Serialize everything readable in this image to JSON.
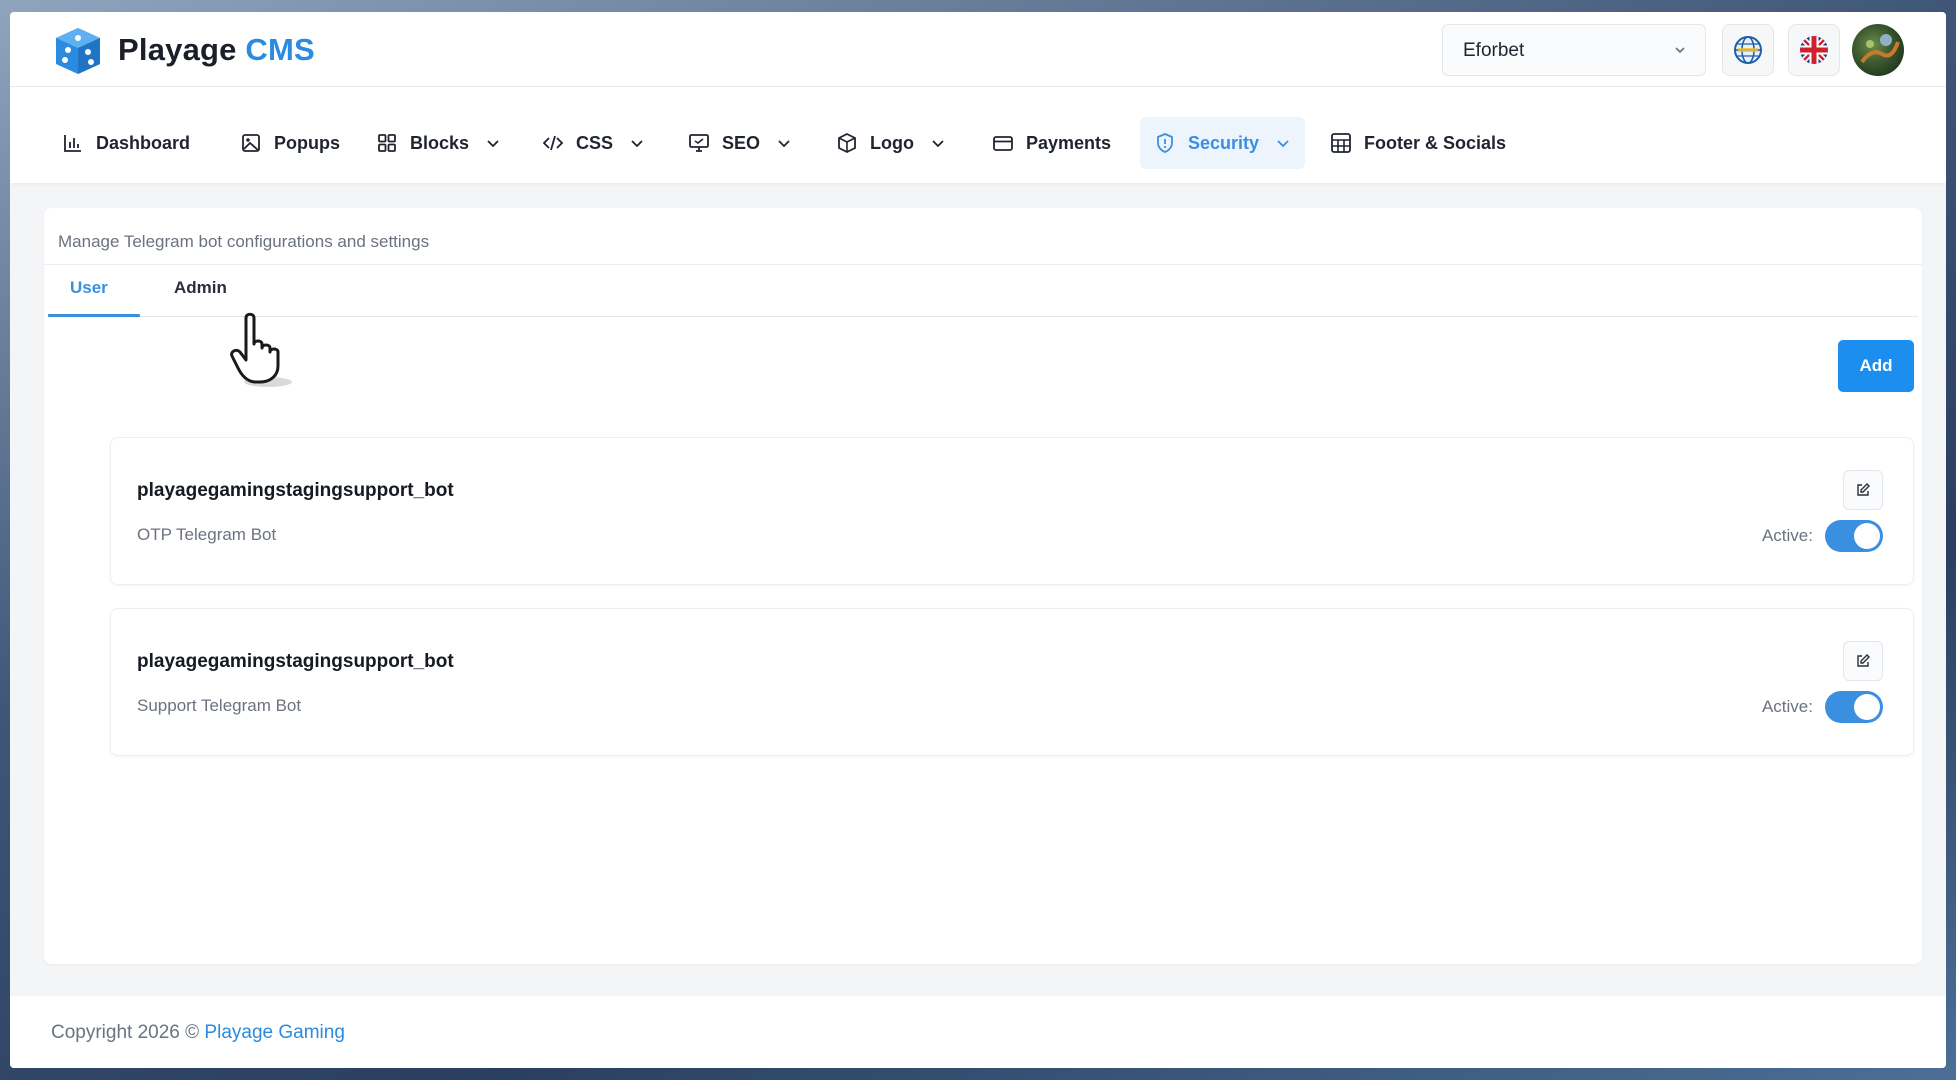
{
  "header": {
    "brand_name": "Playage",
    "brand_suffix": "CMS",
    "site_select_value": "Eforbet",
    "icons": [
      "globe-icon",
      "uk-flag-icon",
      "user-avatar"
    ]
  },
  "nav": {
    "items": [
      {
        "label": "Dashboard",
        "icon": "bar-chart-icon",
        "dropdown": false
      },
      {
        "label": "Popups",
        "icon": "image-icon",
        "dropdown": false
      },
      {
        "label": "Blocks",
        "icon": "grid-icon",
        "dropdown": true
      },
      {
        "label": "CSS",
        "icon": "code-icon",
        "dropdown": true
      },
      {
        "label": "SEO",
        "icon": "monitor-icon",
        "dropdown": true
      },
      {
        "label": "Logo",
        "icon": "box-icon",
        "dropdown": true
      },
      {
        "label": "Payments",
        "icon": "credit-card-icon",
        "dropdown": false
      },
      {
        "label": "Security",
        "icon": "shield-icon",
        "dropdown": true,
        "active": true
      },
      {
        "label": "Footer & Socials",
        "icon": "layout-icon",
        "dropdown": false
      }
    ]
  },
  "page": {
    "description": "Manage Telegram bot configurations and settings",
    "tabs": [
      {
        "label": "User",
        "active": true
      },
      {
        "label": "Admin",
        "active": false
      }
    ],
    "add_label": "Add",
    "bots": [
      {
        "name": "playagegamingstagingsupport_bot",
        "description": "OTP Telegram Bot",
        "active_label": "Active:",
        "active": true
      },
      {
        "name": "playagegamingstagingsupport_bot",
        "description": "Support Telegram Bot",
        "active_label": "Active:",
        "active": true
      }
    ]
  },
  "footer": {
    "copyright": "Copyright 2026 © ",
    "company": "Playage Gaming"
  },
  "colors": {
    "accent": "#3b8fe0",
    "button": "#1c8ef0",
    "text": "#1f2430",
    "muted": "#6b7280"
  }
}
